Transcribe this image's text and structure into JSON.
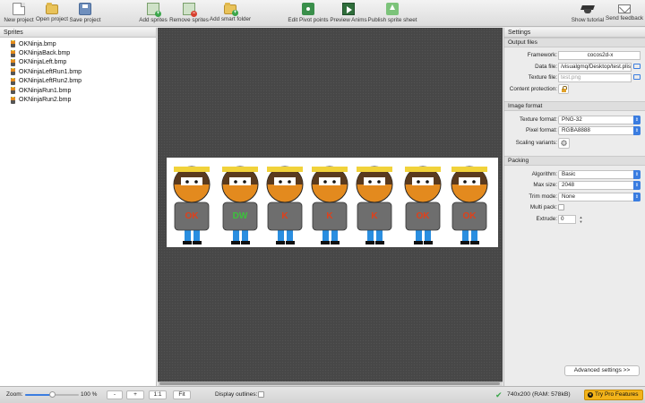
{
  "toolbar": {
    "new_project": "New project",
    "open_project": "Open project",
    "save_project": "Save project",
    "add_sprites": "Add sprites",
    "remove_sprites": "Remove sprites",
    "add_smart_folder": "Add smart folder",
    "edit_pivot_points": "Edit Pivot points",
    "preview_anims": "Preview Anims",
    "publish_sprite_sheet": "Publish sprite sheet",
    "show_tutorial": "Show tutorial",
    "send_feedback": "Send feedback"
  },
  "sprites": {
    "header": "Sprites",
    "items": [
      {
        "name": "OKNinja.bmp"
      },
      {
        "name": "OKNinjaBack.bmp"
      },
      {
        "name": "OKNinjaLeft.bmp"
      },
      {
        "name": "OKNinjaLeftRun1.bmp"
      },
      {
        "name": "OKNinjaLeftRun2.bmp"
      },
      {
        "name": "OKNinjaRun1.bmp"
      },
      {
        "name": "OKNinjaRun2.bmp"
      }
    ]
  },
  "canvas": {
    "ninja_labels": [
      "OK",
      "DW",
      "K",
      "K",
      "K",
      "OK",
      "OK"
    ],
    "colors": {
      "background": "#474747",
      "sheet": "#ffffff",
      "headband": "#f1d23a",
      "skin": "#e38a1e",
      "shirt": "#6e6e6e",
      "pants": "#2a8ee0",
      "label_red": "#e0401a",
      "label_green": "#3cc23c"
    }
  },
  "settings": {
    "header": "Settings",
    "output_files": {
      "header": "Output files",
      "framework_label": "Framework:",
      "framework_value": "cocos2d-x",
      "data_file_label": "Data file:",
      "data_file_value": "/visualgmq/Desktop/test.plist",
      "texture_file_label": "Texture file:",
      "texture_file_placeholder": "test.png",
      "content_protection_label": "Content protection:"
    },
    "image_format": {
      "header": "Image format",
      "texture_format_label": "Texture format:",
      "texture_format_value": "PNG-32",
      "pixel_format_label": "Pixel format:",
      "pixel_format_value": "RGBA8888",
      "scaling_variants_label": "Scaling variants:"
    },
    "packing": {
      "header": "Packing",
      "algorithm_label": "Algorithm:",
      "algorithm_value": "Basic",
      "max_size_label": "Max size:",
      "max_size_value": "2048",
      "trim_mode_label": "Trim mode:",
      "trim_mode_value": "None",
      "multi_pack_label": "Multi pack:",
      "multi_pack_checked": false,
      "extrude_label": "Extrude:",
      "extrude_value": "0"
    },
    "advanced_button": "Advanced settings >>"
  },
  "statusbar": {
    "zoom_label": "Zoom:",
    "zoom_value": "100 %",
    "zoom_level": 0.5,
    "zoom_out": "-",
    "zoom_in": "+",
    "zoom_1_1": "1:1",
    "zoom_fit": "Fit",
    "display_outlines_label": "Display outlines:",
    "display_outlines_checked": false,
    "sheet_info": "740x200 (RAM: 578kB)",
    "try_pro": "Try Pro Features"
  }
}
